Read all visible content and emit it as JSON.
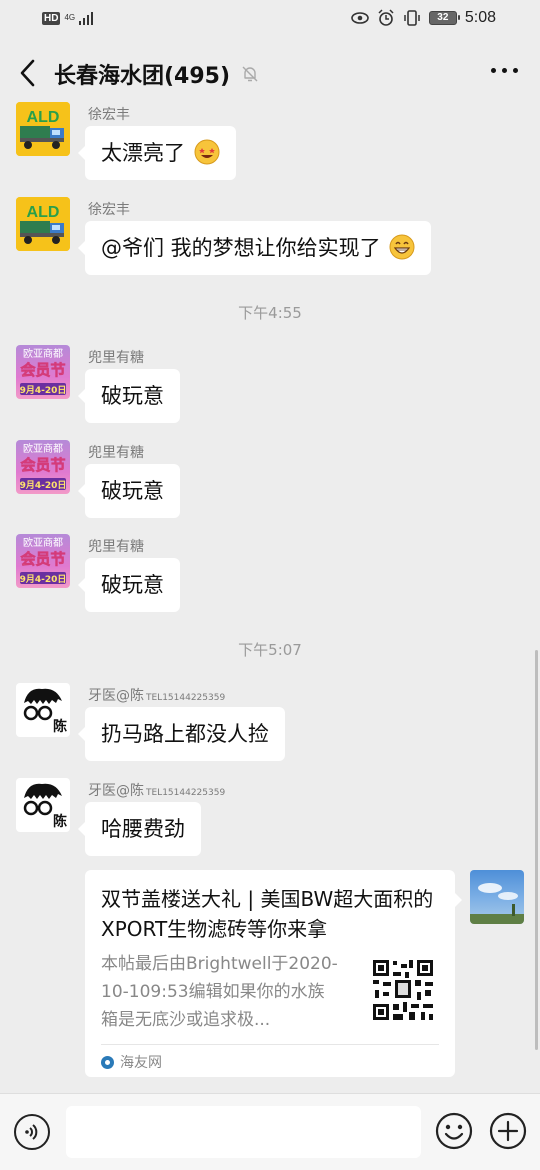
{
  "status_bar": {
    "hd_label": "HD",
    "network_label": "4G",
    "time": "5:08",
    "battery": "32",
    "icons": [
      "eye-icon",
      "alarm-icon",
      "vibrate-icon"
    ]
  },
  "header": {
    "title": "长春海水团(495)",
    "icons": {
      "back": "chevron-left-icon",
      "mute": "bell-off-icon",
      "more": "more-dots-icon"
    }
  },
  "timestamps": [
    "下午4:55",
    "下午5:07"
  ],
  "messages": [
    {
      "sender": "徐宏丰",
      "text": "太漂亮了",
      "emoji": "star-struck-emoji",
      "avatar": "ald-truck-avatar"
    },
    {
      "sender": "徐宏丰",
      "text": "@爷们  我的梦想让你给实现了",
      "emoji": "grinning-emoji",
      "avatar": "ald-truck-avatar"
    },
    {
      "sender": "兜里有糖",
      "text": "破玩意",
      "avatar": "member-festival-avatar"
    },
    {
      "sender": "兜里有糖",
      "text": "破玩意",
      "avatar": "member-festival-avatar"
    },
    {
      "sender": "兜里有糖",
      "text": "破玩意",
      "avatar": "member-festival-avatar"
    },
    {
      "sender": "牙医@陈",
      "sender_phone": "TEL15144225359",
      "text": "扔马路上都没人捡",
      "avatar": "glasses-face-avatar"
    },
    {
      "sender": "牙医@陈",
      "sender_phone": "TEL15144225359",
      "text": "哈腰费劲",
      "avatar": "glasses-face-avatar"
    }
  ],
  "avatar_text": {
    "ald": "ALD",
    "shop_line1": "欧亚商都",
    "shop_line2": "会员节",
    "shop_line3": "9月4-20日",
    "face_tag": "陈"
  },
  "link_card": {
    "title": "双节盖楼送大礼 | 美国BW超大面积的XPORT生物滤砖等你来拿",
    "description": "本帖最后由Brightwell于2020-10-109:53编辑如果你的水族箱是无底沙或追求极...",
    "source": "海友网",
    "thumbnail": "qr-code-icon",
    "sender_avatar": "sky-photo-avatar"
  },
  "input_bar": {
    "value": "",
    "icons": {
      "voice": "voice-icon",
      "emoji": "smile-icon",
      "plus": "plus-circle-icon"
    }
  },
  "colors": {
    "background": "#ededed",
    "bubble": "#ffffff",
    "meta_text": "#7b7b7b"
  }
}
